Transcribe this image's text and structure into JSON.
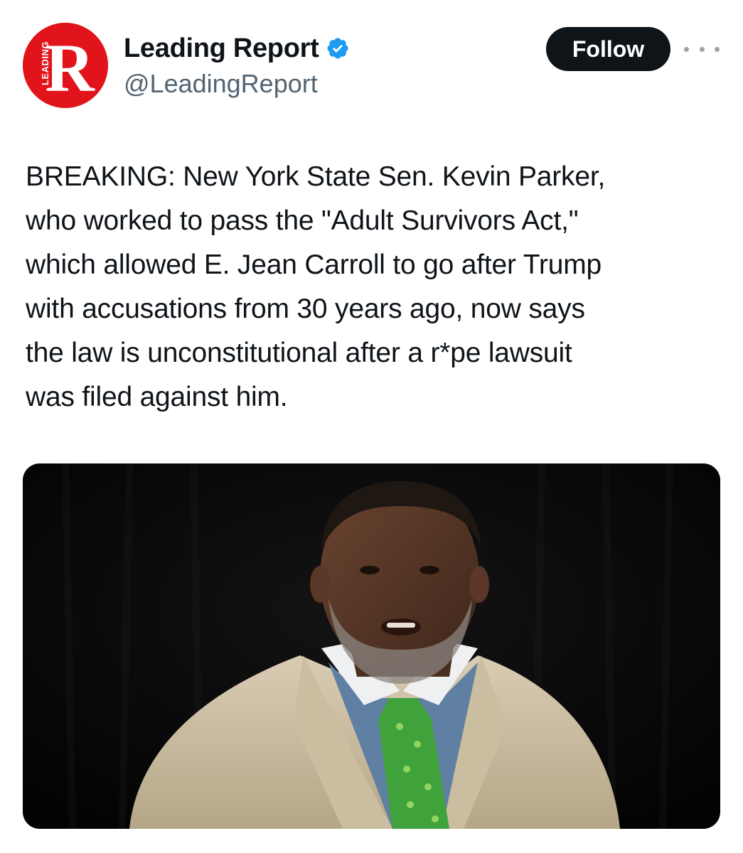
{
  "tweet": {
    "author": {
      "display_name": "Leading Report",
      "handle": "@LeadingReport",
      "verified": true,
      "avatar": {
        "letter": "R",
        "side_text": "LEADING",
        "color": "#e2141b"
      }
    },
    "follow_label": "Follow",
    "more_icon": "ellipsis-icon",
    "text": "BREAKING: New York State Sen. Kevin Parker,\nwho worked to pass the \"Adult Survivors Act,\"\nwhich allowed E. Jean Carroll to go after Trump\nwith accusations from 30 years ago, now says\nthe law is unconstitutional after a r*pe lawsuit\nwas filed against him.",
    "media": {
      "type": "photo",
      "background_color": "#070707"
    }
  },
  "colors": {
    "text_primary": "#0f1419",
    "text_secondary": "#536471",
    "verified_blue": "#1d9bf0",
    "follow_button_bg": "#0f1419"
  }
}
